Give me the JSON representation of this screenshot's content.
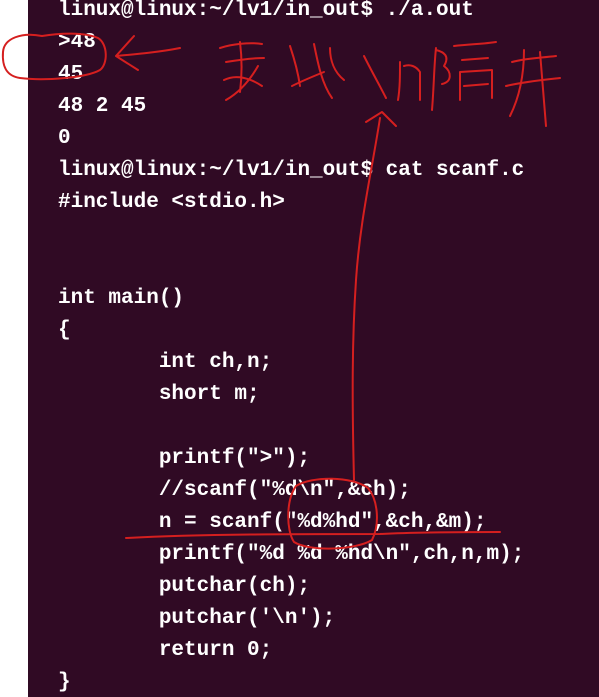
{
  "terminal": {
    "background": "#300a24",
    "foreground": "#ffffff",
    "lines": [
      "linux@linux:~/lv1/in_out$ ./a.out",
      ">48",
      "45",
      "48 2 45",
      "0",
      "linux@linux:~/lv1/in_out$ cat scanf.c",
      "#include <stdio.h>",
      "",
      "",
      "int main()",
      "{",
      "        int ch,n;",
      "        short m;",
      "",
      "        printf(\">\");",
      "        //scanf(\"%d\\n\",&ch);",
      "        n = scanf(\"%d%hd\",&ch,&m);",
      "        printf(\"%d %d %hd\\n\",ch,n,m);",
      "        putchar(ch);",
      "        putchar('\\n');",
      "        return 0;",
      "}"
    ]
  },
  "annotation": {
    "color": "#d51f1f",
    "handwritten_note": "要以\\n隔开"
  }
}
